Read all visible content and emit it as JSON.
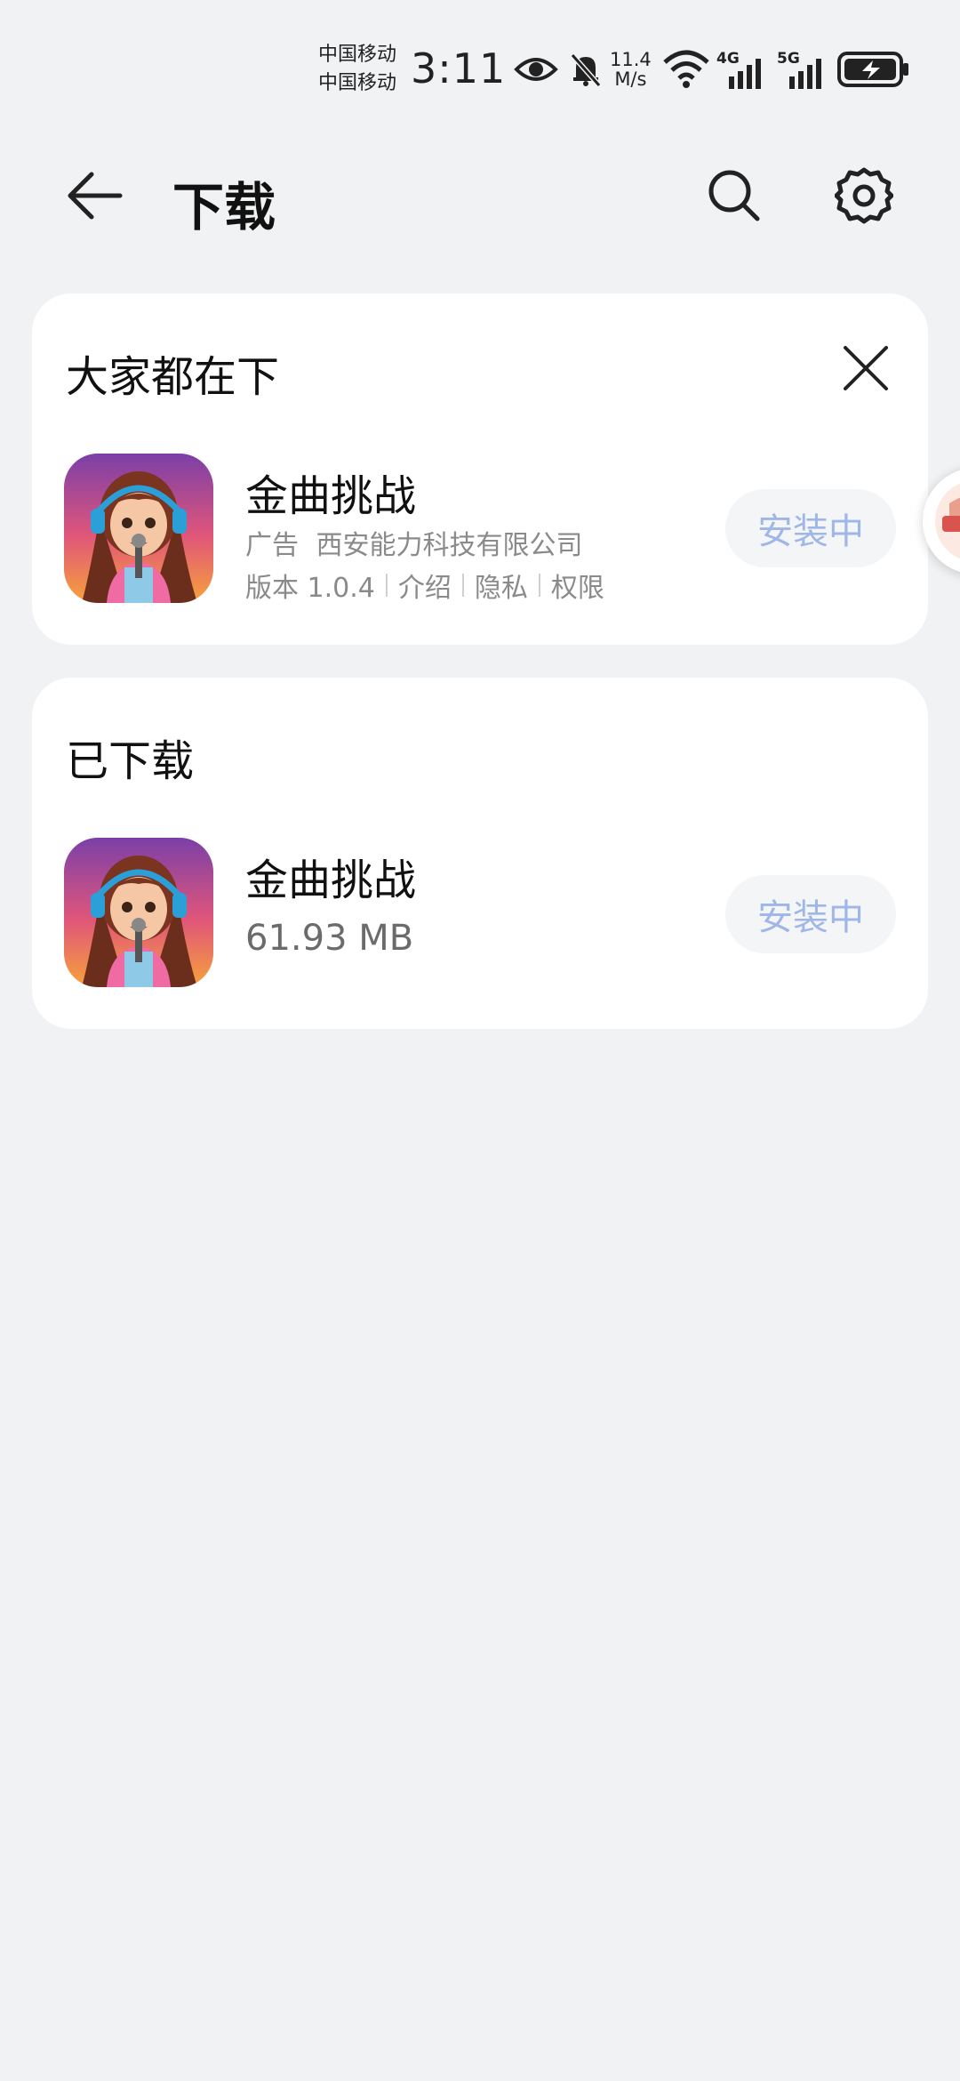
{
  "status_bar": {
    "carrier_1": "中国移动",
    "carrier_2": "中国移动",
    "time": "3:11",
    "net_speed_value": "11.4",
    "net_speed_unit": "M/s",
    "signal_1": "4G",
    "signal_2": "5G",
    "icons": [
      "eye-icon",
      "bell-muted-icon",
      "wifi-icon",
      "signal-4g-icon",
      "signal-5g-icon",
      "battery-charging-icon"
    ]
  },
  "header": {
    "title": "下载",
    "icons": [
      "back-arrow-icon",
      "search-icon",
      "gear-icon"
    ]
  },
  "recommended": {
    "title": "大家都在下",
    "app": {
      "name": "金曲挑战",
      "ad_label": "广告",
      "developer": "西安能力科技有限公司",
      "version": "版本 1.0.4",
      "links": [
        "介绍",
        "隐私",
        "权限"
      ],
      "button_label": "安装中"
    }
  },
  "downloaded": {
    "title": "已下载",
    "app": {
      "name": "金曲挑战",
      "size": "61.93 MB",
      "button_label": "安装中"
    }
  },
  "colors": {
    "background": "#f1f2f4",
    "card": "#ffffff",
    "install_text": "#9fb6e8",
    "secondary_text": "#8a8a8a"
  }
}
